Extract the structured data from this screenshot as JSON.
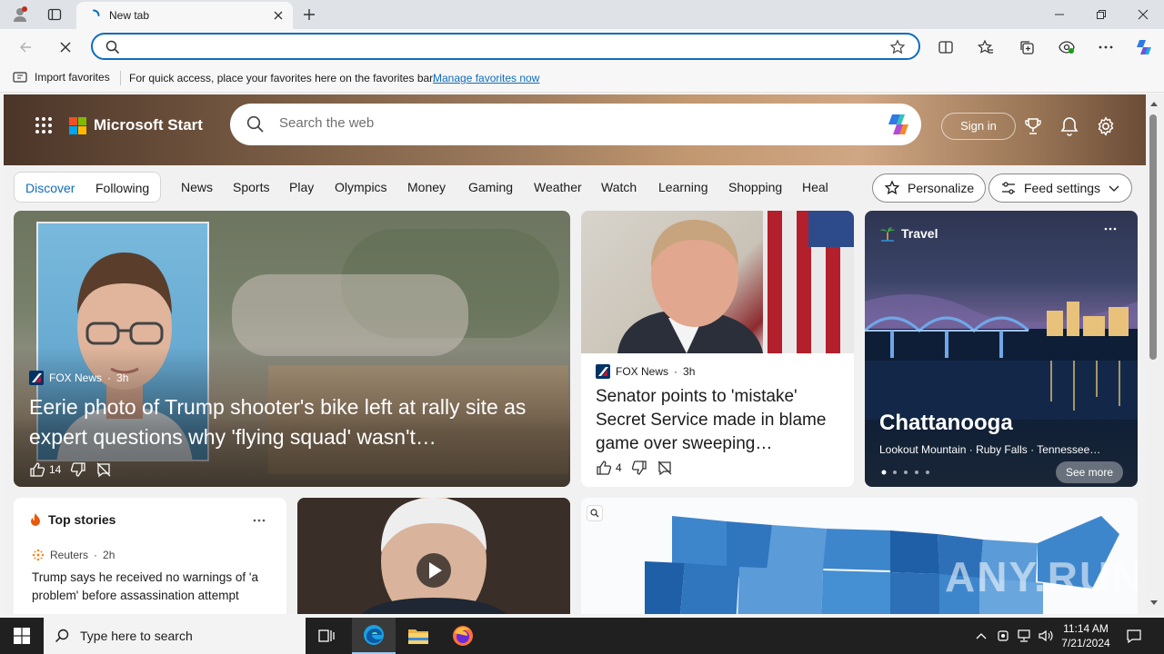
{
  "browser": {
    "tab_title": "New tab",
    "address_value": "",
    "address_placeholder": ""
  },
  "favorites_bar": {
    "import_label": "Import favorites",
    "hint": "For quick access, place your favorites here on the favorites bar.",
    "manage_link": "Manage favorites now"
  },
  "msstart": {
    "brand": "Microsoft Start",
    "search_placeholder": "Search the web",
    "sign_in": "Sign in",
    "feed_tabs": [
      "Discover",
      "Following"
    ],
    "categories": [
      "News",
      "Sports",
      "Play",
      "Olympics",
      "Money",
      "Gaming",
      "Weather",
      "Watch",
      "Learning",
      "Shopping",
      "Heal"
    ],
    "personalize": "Personalize",
    "feed_settings": "Feed settings",
    "accent": "#0f6cbd"
  },
  "cards": {
    "lead": {
      "source": "FOX News",
      "age": "3h",
      "headline": "Eerie photo of Trump shooter's bike left at rally site as expert questions why 'flying squad' wasn't…",
      "likes": "14"
    },
    "second": {
      "source": "FOX News",
      "age": "3h",
      "headline": "Senator points to 'mistake' Secret Service made in blame game over sweeping…",
      "likes": "4"
    },
    "travel": {
      "category": "Travel",
      "title": "Chattanooga",
      "subtitle": "Lookout Mountain · Ruby Falls · Tennessee…",
      "see_more": "See more"
    },
    "top_stories": {
      "heading": "Top stories",
      "source": "Reuters",
      "age": "2h",
      "headline": "Trump says he received no warnings of 'a problem' before assassination attempt"
    }
  },
  "taskbar": {
    "search_placeholder": "Type here to search",
    "time": "11:14 AM",
    "date": "7/21/2024"
  }
}
